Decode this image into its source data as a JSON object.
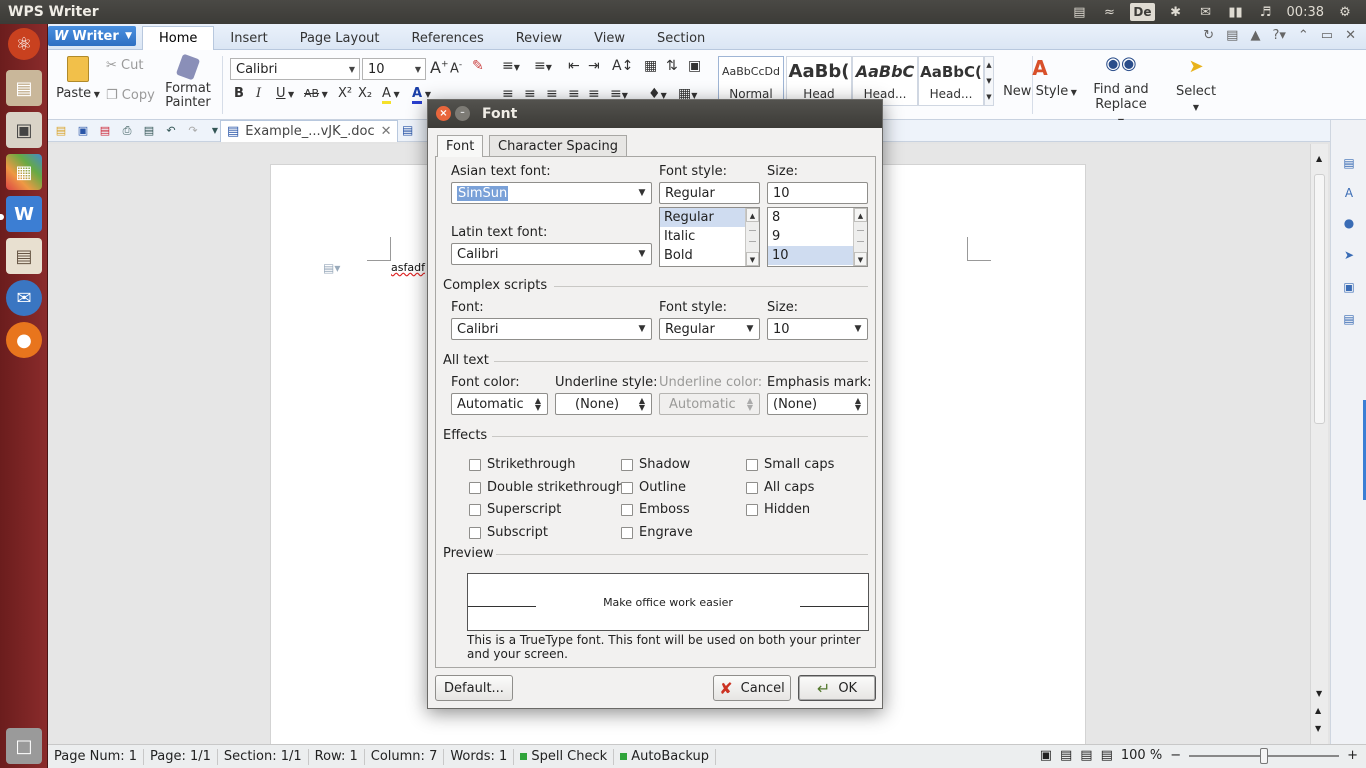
{
  "top_panel": {
    "app_title": "WPS Writer",
    "keyboard_layout": "De",
    "clock": "00:38",
    "icons": [
      "book-icon",
      "wifi-icon",
      "bluetooth-icon",
      "mail-icon",
      "battery-icon",
      "volume-icon",
      "gear-icon"
    ]
  },
  "launcher": {
    "items": [
      "ubuntu-logo",
      "files",
      "manager",
      "palette",
      "wps-writer",
      "reader",
      "thunderbird",
      "firefox",
      "trash"
    ]
  },
  "wps": {
    "writer_button": {
      "logo": "W",
      "label": "Writer"
    },
    "tabs": [
      "Home",
      "Insert",
      "Page Layout",
      "References",
      "Review",
      "View",
      "Section"
    ],
    "active_tab": "Home",
    "help_label": "?",
    "ribbon": {
      "paste": "Paste",
      "cut": "Cut",
      "copy": "Copy",
      "format_painter": [
        "Format",
        "Painter"
      ],
      "font_name": "Calibri",
      "font_size": "10",
      "format_letters": {
        "bold": "B",
        "italic": "I",
        "underline": "U",
        "strikethrough": "AB",
        "superscript": "X²",
        "subscript": "X₂",
        "increase_font": "A",
        "decrease_font": "A",
        "font_color": "A",
        "highlight": "A"
      },
      "styles": [
        {
          "sample": "AaBbCcDd",
          "name": "Normal"
        },
        {
          "sample": "AaBb(",
          "name": "Head"
        },
        {
          "sample": "AaBbC",
          "name": "Head..."
        },
        {
          "sample": "AaBbC(",
          "name": "Head..."
        }
      ],
      "new_style": "New Style",
      "find_replace": [
        "Find and",
        "Replace"
      ],
      "select": "Select"
    },
    "doc_tab": "Example_...vJK_.doc",
    "document_text": "asfadf",
    "status": {
      "page_num": "Page Num: 1",
      "page": "Page: 1/1",
      "section": "Section: 1/1",
      "row": "Row: 1",
      "column": "Column: 7",
      "words": "Words: 1",
      "spell_check": "Spell Check",
      "autobackup": "AutoBackup",
      "zoom": "100 %",
      "zoom_level": 0.5
    }
  },
  "dialog": {
    "title": "Font",
    "close_glyph": "×",
    "min_glyph": "–",
    "tabs": [
      "Font",
      "Character Spacing"
    ],
    "asian_font_label": "Asian text font:",
    "asian_font_value": "SimSun",
    "latin_font_label": "Latin text font:",
    "latin_font_value": "Calibri",
    "font_style_label": "Font style:",
    "font_style_value": "Regular",
    "font_style_options": [
      "Regular",
      "Italic",
      "Bold"
    ],
    "size_label": "Size:",
    "size_value": "10",
    "size_options": [
      "8",
      "9",
      "10"
    ],
    "complex_scripts": {
      "heading": "Complex scripts",
      "font_label": "Font:",
      "font_value": "Calibri",
      "style_label": "Font style:",
      "style_value": "Regular",
      "size_label": "Size:",
      "size_value": "10"
    },
    "all_text": {
      "heading": "All text",
      "font_color_label": "Font color:",
      "font_color_value": "Automatic",
      "underline_style_label": "Underline style:",
      "underline_style_value": "(None)",
      "underline_color_label": "Underline color:",
      "underline_color_value": "Automatic",
      "emphasis_label": "Emphasis mark:",
      "emphasis_value": "(None)"
    },
    "effects": {
      "heading": "Effects",
      "col1": [
        "Strikethrough",
        "Double strikethrough",
        "Superscript",
        "Subscript"
      ],
      "col2": [
        "Shadow",
        "Outline",
        "Emboss",
        "Engrave"
      ],
      "col3": [
        "Small caps",
        "All caps",
        "Hidden"
      ]
    },
    "preview": {
      "heading": "Preview",
      "sample": "Make office work easier",
      "description": "This is a TrueType font. This font will be used on both your printer and your screen."
    },
    "buttons": {
      "default": "Default...",
      "cancel": "Cancel",
      "ok": "OK"
    }
  }
}
